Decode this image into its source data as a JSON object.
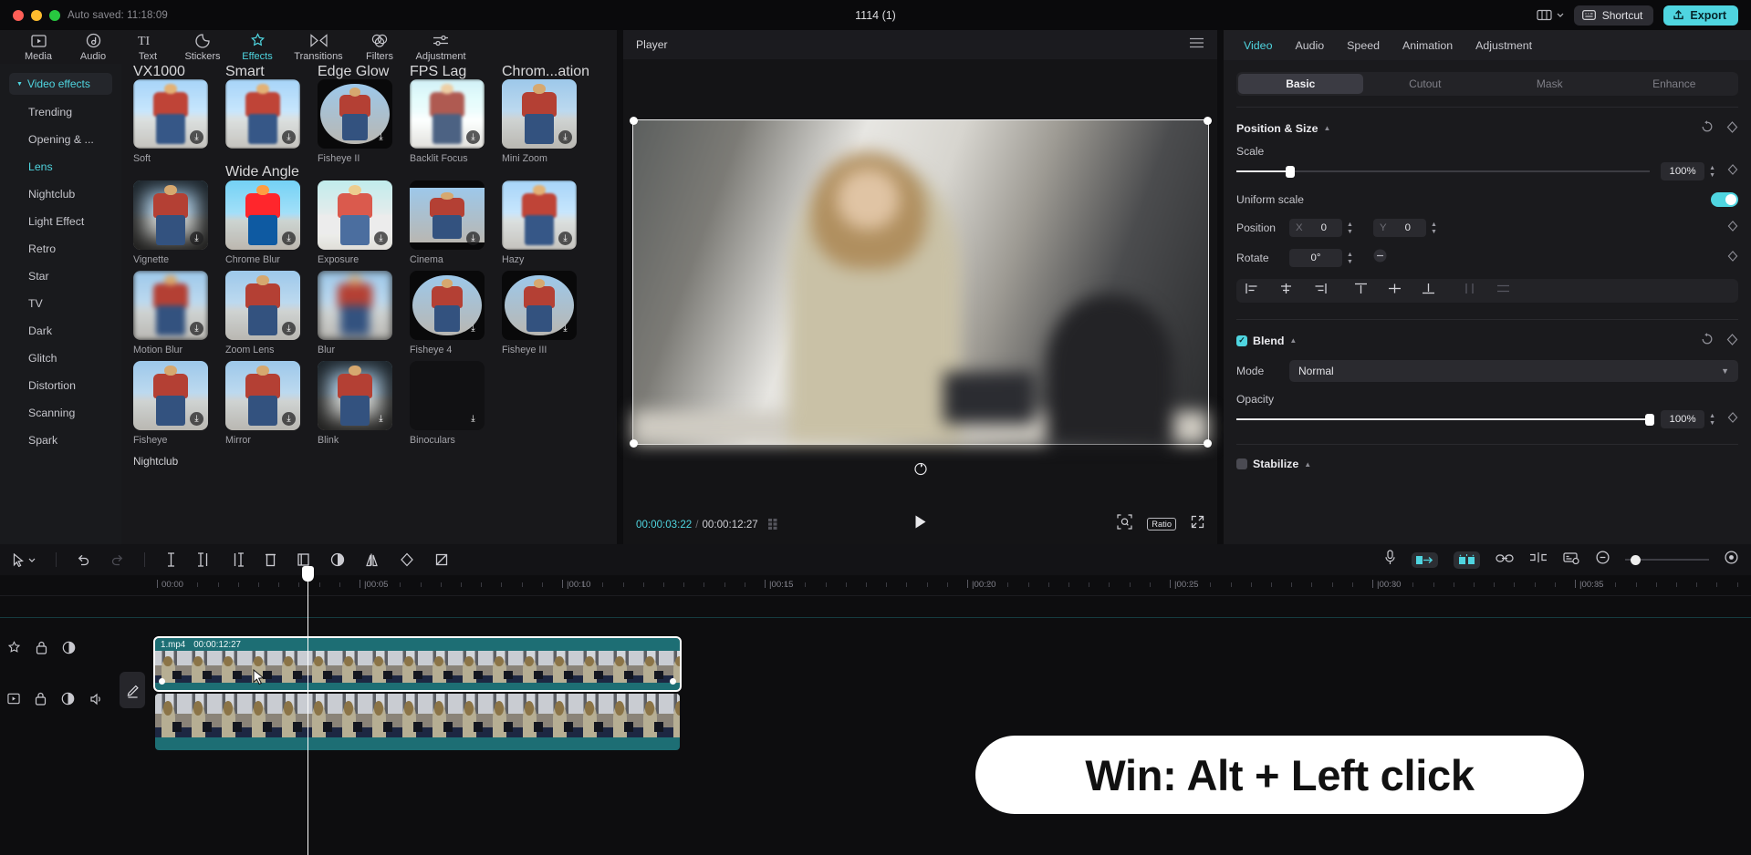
{
  "titlebar": {
    "autosave": "Auto saved: 11:18:09",
    "doc_title": "1114 (1)",
    "shortcut_label": "Shortcut",
    "export_label": "Export"
  },
  "main_tabs": [
    {
      "label": "Media",
      "icon": "media-icon",
      "active": false
    },
    {
      "label": "Audio",
      "icon": "audio-icon",
      "active": false
    },
    {
      "label": "Text",
      "icon": "text-icon",
      "active": false
    },
    {
      "label": "Stickers",
      "icon": "stickers-icon",
      "active": false
    },
    {
      "label": "Effects",
      "icon": "effects-icon",
      "active": true
    },
    {
      "label": "Transitions",
      "icon": "transitions-icon",
      "active": false
    },
    {
      "label": "Filters",
      "icon": "filters-icon",
      "active": false
    },
    {
      "label": "Adjustment",
      "icon": "adjustment-icon",
      "active": false
    }
  ],
  "categories": {
    "header": "Video effects",
    "items": [
      {
        "label": "Trending",
        "active": false
      },
      {
        "label": "Opening & ...",
        "active": false
      },
      {
        "label": "Lens",
        "active": true
      },
      {
        "label": "Nightclub",
        "active": false
      },
      {
        "label": "Light Effect",
        "active": false
      },
      {
        "label": "Retro",
        "active": false
      },
      {
        "label": "Star",
        "active": false
      },
      {
        "label": "TV",
        "active": false
      },
      {
        "label": "Dark",
        "active": false
      },
      {
        "label": "Glitch",
        "active": false
      },
      {
        "label": "Distortion",
        "active": false
      },
      {
        "label": "Scanning",
        "active": false
      },
      {
        "label": "Spark",
        "active": false
      }
    ]
  },
  "effects": {
    "clipped_top_labels": [
      "VX1000",
      "Smart Sharpen",
      "Edge Glow",
      "FPS Lag",
      "Chrom...ation"
    ],
    "partial_label": "Wide Angle",
    "section_label": "Nightclub",
    "items": [
      {
        "label": "Soft",
        "style": "soft",
        "download": true
      },
      {
        "label": "Fisheye II",
        "style": "circle-dark",
        "download": true
      },
      {
        "label": "Backlit Focus",
        "style": "wash",
        "download": true
      },
      {
        "label": "Mini Zoom",
        "style": "plain",
        "download": true
      },
      {
        "label": "Vignette",
        "style": "vignette",
        "download": true
      },
      {
        "label": "Chrome Blur",
        "style": "rainbow",
        "download": true
      },
      {
        "label": "Exposure",
        "style": "bright",
        "download": true
      },
      {
        "label": "Cinema",
        "style": "letterbox",
        "download": true
      },
      {
        "label": "Hazy",
        "style": "soft",
        "download": true
      },
      {
        "label": "Motion Blur",
        "style": "blur",
        "download": true
      },
      {
        "label": "Zoom Lens",
        "style": "plain",
        "download": true
      },
      {
        "label": "Blur",
        "style": "blur2",
        "download": false
      },
      {
        "label": "Fisheye 4",
        "style": "circle-dark",
        "download": true
      },
      {
        "label": "Fisheye III",
        "style": "circle-dark",
        "download": true
      },
      {
        "label": "Fisheye",
        "style": "plain",
        "download": true
      },
      {
        "label": "Mirror",
        "style": "plain",
        "download": true
      },
      {
        "label": "Blink",
        "style": "vignette",
        "download": true
      },
      {
        "label": "Binoculars",
        "style": "blank",
        "download": true
      }
    ],
    "row0": [
      "Soft",
      "Soft",
      "Fisheye II",
      "Backlit Focus",
      "Mini Zoom"
    ],
    "row0_styles": [
      "soft",
      "soft",
      "circle-dark",
      "wash",
      "plain"
    ]
  },
  "player": {
    "title": "Player",
    "current_time": "00:00:03:22",
    "total_time": "00:00:12:27",
    "ratio_label": "Ratio",
    "menu_icon": "hamburger-icon",
    "play_icon": "play-icon",
    "rotate_icon": "rotate-icon",
    "fullscreen_icon": "fullscreen-icon",
    "zoom_icon": "zoom-fit-icon",
    "quality_icon": "quality-icon"
  },
  "properties": {
    "tabs": [
      {
        "label": "Video",
        "active": true
      },
      {
        "label": "Audio",
        "active": false
      },
      {
        "label": "Speed",
        "active": false
      },
      {
        "label": "Animation",
        "active": false
      },
      {
        "label": "Adjustment",
        "active": false
      }
    ],
    "segments": [
      {
        "label": "Basic",
        "active": true
      },
      {
        "label": "Cutout",
        "active": false
      },
      {
        "label": "Mask",
        "active": false
      },
      {
        "label": "Enhance",
        "active": false
      }
    ],
    "position_size": {
      "title": "Position & Size",
      "scale_label": "Scale",
      "scale_value": "100%",
      "scale_percent": 13,
      "uniform_scale_label": "Uniform scale",
      "uniform_scale_on": true,
      "position_label": "Position",
      "position_x_axis": "X",
      "position_x": "0",
      "position_y_axis": "Y",
      "position_y": "0",
      "rotate_label": "Rotate",
      "rotate_value": "0°"
    },
    "blend": {
      "title": "Blend",
      "enabled": true,
      "mode_label": "Mode",
      "mode_value": "Normal",
      "opacity_label": "Opacity",
      "opacity_value": "100%",
      "opacity_percent": 100
    },
    "stabilize": {
      "title": "Stabilize",
      "enabled": false
    }
  },
  "timeline": {
    "ruler_labels": [
      "00:00",
      "00:05",
      "00:10",
      "00:15",
      "00:20",
      "00:25",
      "00:30",
      "00:35"
    ],
    "tools": [
      {
        "name": "select-tool",
        "icon": "cursor-icon"
      },
      {
        "name": "undo",
        "icon": "undo-icon"
      },
      {
        "name": "redo",
        "icon": "redo-icon"
      },
      {
        "name": "split",
        "icon": "split-icon"
      },
      {
        "name": "trim-start",
        "icon": "trim-start-icon"
      },
      {
        "name": "trim-end",
        "icon": "trim-end-icon"
      },
      {
        "name": "delete",
        "icon": "delete-icon"
      },
      {
        "name": "crop",
        "icon": "crop-icon"
      },
      {
        "name": "color-match",
        "icon": "color-match-icon"
      },
      {
        "name": "mirror",
        "icon": "mirror-icon"
      },
      {
        "name": "keyframe",
        "icon": "keyframe-icon"
      },
      {
        "name": "freeze",
        "icon": "freeze-icon"
      }
    ],
    "clip": {
      "name": "1.mp4",
      "duration": "00:00:12:27",
      "selected": true
    },
    "callout": "Win: Alt + Left click"
  },
  "colors": {
    "accent": "#4fd5e0",
    "clip_teal": "#1d6e74",
    "panel_bg": "#18181b",
    "app_bg": "#0d0d0f"
  }
}
